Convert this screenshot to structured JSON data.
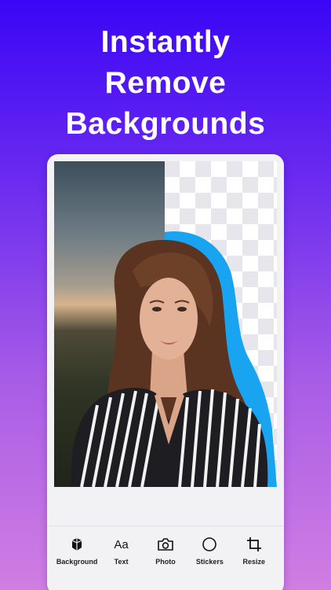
{
  "headline": {
    "lines": [
      "Instantly",
      "Remove",
      "Backgrounds"
    ]
  },
  "toolbar": {
    "items": [
      {
        "label": "Background",
        "icon": "background-icon"
      },
      {
        "label": "Text",
        "icon": "text-icon",
        "glyph": "Aa"
      },
      {
        "label": "Photo",
        "icon": "camera-icon"
      },
      {
        "label": "Stickers",
        "icon": "sticker-circle-icon"
      },
      {
        "label": "Resize",
        "icon": "crop-icon"
      }
    ]
  },
  "colors": {
    "gradient_top": "#3a06f5",
    "gradient_bottom": "#d17ee2",
    "cutout_outline": "#19a4f2"
  }
}
